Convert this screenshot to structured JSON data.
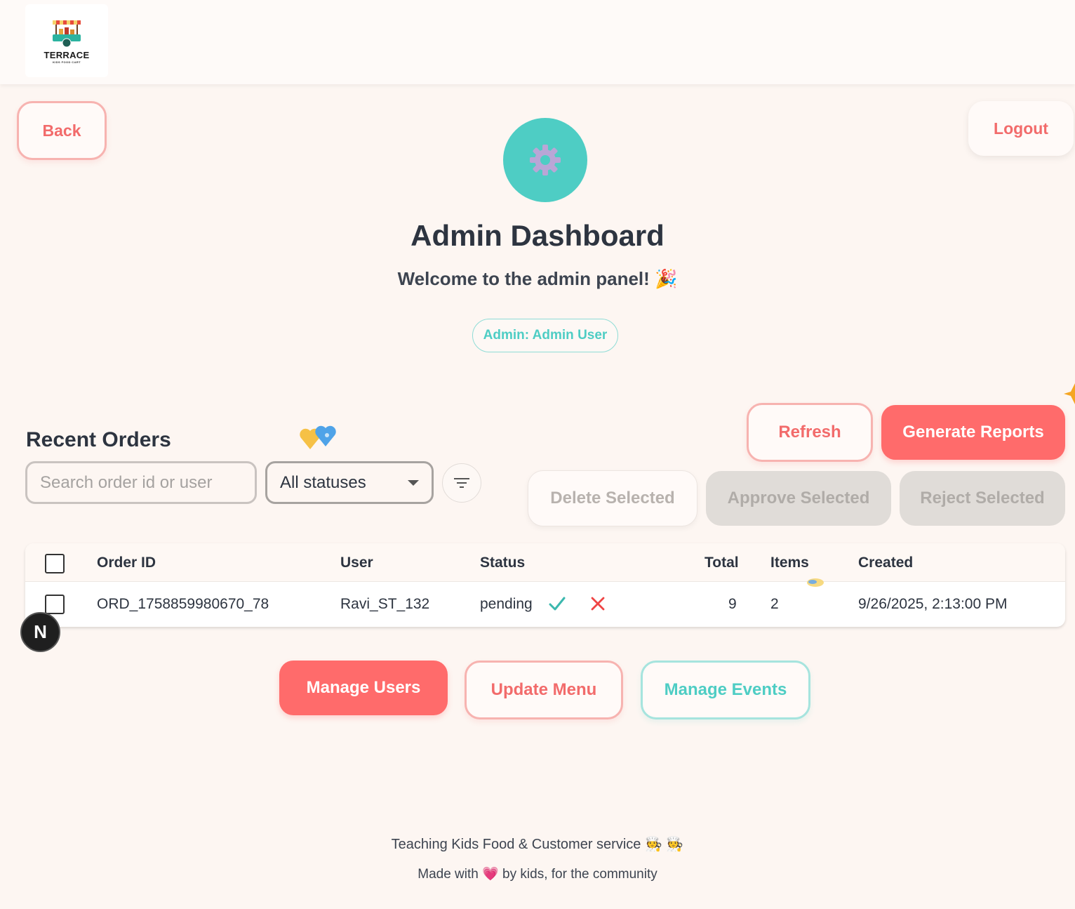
{
  "brand": {
    "logo_text": "TERRACE",
    "logo_subtext": "KIDS FOOD CART"
  },
  "nav": {
    "back_label": "Back",
    "logout_label": "Logout"
  },
  "header": {
    "title": "Admin Dashboard",
    "subtitle": "Welcome to the admin panel! 🎉",
    "admin_badge": "Admin: Admin User"
  },
  "orders": {
    "section_title": "Recent Orders",
    "search_placeholder": "Search order id or user",
    "status_filter_value": "All statuses",
    "refresh_label": "Refresh",
    "generate_reports_label": "Generate Reports",
    "delete_selected_label": "Delete Selected",
    "approve_selected_label": "Approve Selected",
    "reject_selected_label": "Reject Selected",
    "columns": [
      "Order ID",
      "User",
      "Status",
      "Total",
      "Items",
      "Created"
    ],
    "rows": [
      {
        "order_id": "ORD_1758859980670_78",
        "user": "Ravi_ST_132",
        "status": "pending",
        "total": "9",
        "items": "2",
        "created": "9/26/2025, 2:13:00 PM"
      }
    ]
  },
  "actions": {
    "manage_users_label": "Manage Users",
    "update_menu_label": "Update Menu",
    "manage_events_label": "Manage Events"
  },
  "footer": {
    "line1": "Teaching Kids Food & Customer service 🧑‍🍳 🧑‍🍳",
    "line2": "Made with 💗 by kids, for the community"
  },
  "dev_badge": "N",
  "colors": {
    "accent_red": "#ff6b6b",
    "accent_teal": "#4ecdc4",
    "background": "#fdf6f2"
  },
  "icons": {
    "header": "gear-icon",
    "filter": "filter-icon",
    "approve": "check-icon",
    "reject": "x-icon"
  }
}
